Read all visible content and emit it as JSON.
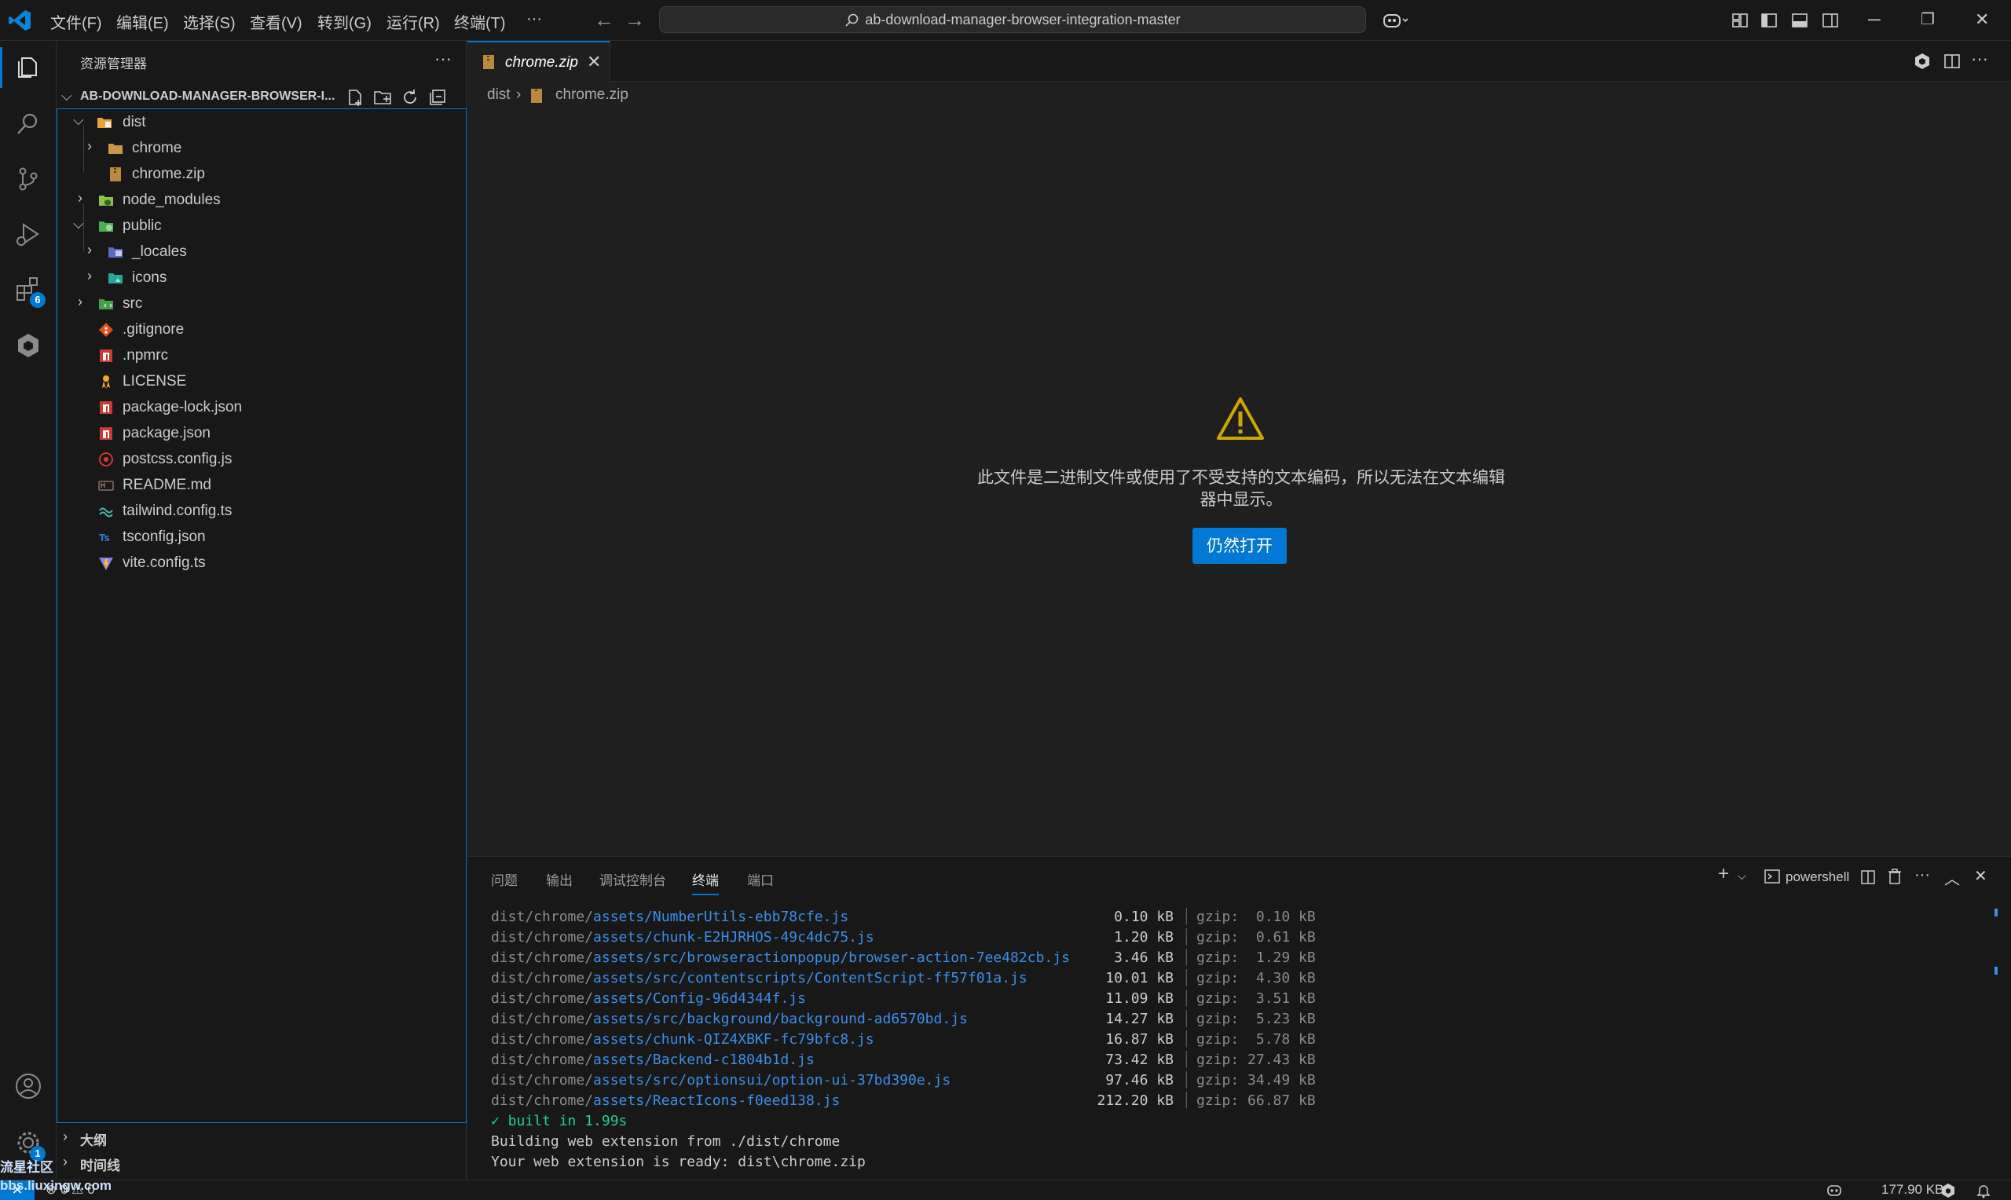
{
  "titlebar": {
    "menus": [
      "文件(F)",
      "编辑(E)",
      "选择(S)",
      "查看(V)",
      "转到(G)",
      "运行(R)",
      "终端(T)",
      "···"
    ],
    "search_text": "ab-download-manager-browser-integration-master"
  },
  "activitybar": {
    "extensions_badge": "6",
    "settings_badge": "1"
  },
  "sidebar": {
    "header": "资源管理器",
    "more": "···",
    "root_title": "AB-DOWNLOAD-MANAGER-BROWSER-I...",
    "tree": [
      {
        "name": "dist",
        "icon": "folder-dist-open-icon"
      },
      {
        "name": "chrome",
        "icon": "folder-chrome-icon"
      },
      {
        "name": "chrome.zip",
        "icon": "zip-file-icon"
      },
      {
        "name": "node_modules",
        "icon": "folder-node-icon"
      },
      {
        "name": "public",
        "icon": "folder-public-open-icon"
      },
      {
        "name": "_locales",
        "icon": "folder-locales-icon"
      },
      {
        "name": "icons",
        "icon": "folder-icons-icon"
      },
      {
        "name": "src",
        "icon": "folder-src-icon"
      },
      {
        "name": ".gitignore",
        "icon": "git-icon"
      },
      {
        "name": ".npmrc",
        "icon": "npm-icon"
      },
      {
        "name": "LICENSE",
        "icon": "license-icon"
      },
      {
        "name": "package-lock.json",
        "icon": "npm-icon"
      },
      {
        "name": "package.json",
        "icon": "npm-icon"
      },
      {
        "name": "postcss.config.js",
        "icon": "postcss-icon"
      },
      {
        "name": "README.md",
        "icon": "markdown-icon"
      },
      {
        "name": "tailwind.config.ts",
        "icon": "tailwind-icon"
      },
      {
        "name": "tsconfig.json",
        "icon": "typescript-config-icon"
      },
      {
        "name": "vite.config.ts",
        "icon": "vite-icon"
      }
    ],
    "outline": "大纲",
    "timeline": "时间线"
  },
  "editor": {
    "tab_label": "chrome.zip",
    "breadcrumb": [
      "dist",
      "chrome.zip"
    ],
    "message": "此文件是二进制文件或使用了不受支持的文本编码，所以无法在文本编辑器中显示。",
    "open_anyway": "仍然打开"
  },
  "panel": {
    "tabs": [
      "问题",
      "输出",
      "调试控制台",
      "终端",
      "端口"
    ],
    "active_tab": "终端",
    "shell": "powershell",
    "lines": [
      {
        "prefix": "dist/chrome/",
        "asset": "assets/NumberUtils-ebb78cfe.js",
        "size": "0.10 kB",
        "gzip": "gzip:  0.10 kB"
      },
      {
        "prefix": "dist/chrome/",
        "asset": "assets/chunk-E2HJRHOS-49c4dc75.js",
        "size": "1.20 kB",
        "gzip": "gzip:  0.61 kB"
      },
      {
        "prefix": "dist/chrome/",
        "asset": "assets/src/browseractionpopup/browser-action-7ee482cb.js",
        "size": "3.46 kB",
        "gzip": "gzip:  1.29 kB"
      },
      {
        "prefix": "dist/chrome/",
        "asset": "assets/src/contentscripts/ContentScript-ff57f01a.js",
        "size": "10.01 kB",
        "gzip": "gzip:  4.30 kB"
      },
      {
        "prefix": "dist/chrome/",
        "asset": "assets/Config-96d4344f.js",
        "size": "11.09 kB",
        "gzip": "gzip:  3.51 kB"
      },
      {
        "prefix": "dist/chrome/",
        "asset": "assets/src/background/background-ad6570bd.js",
        "size": "14.27 kB",
        "gzip": "gzip:  5.23 kB"
      },
      {
        "prefix": "dist/chrome/",
        "asset": "assets/chunk-QIZ4XBKF-fc79bfc8.js",
        "size": "16.87 kB",
        "gzip": "gzip:  5.78 kB"
      },
      {
        "prefix": "dist/chrome/",
        "asset": "assets/Backend-c1804b1d.js",
        "size": "73.42 kB",
        "gzip": "gzip: 27.43 kB"
      },
      {
        "prefix": "dist/chrome/",
        "asset": "assets/src/optionsui/option-ui-37bd390e.js",
        "size": "97.46 kB",
        "gzip": "gzip: 34.49 kB"
      },
      {
        "prefix": "dist/chrome/",
        "asset": "assets/ReactIcons-f0eed138.js",
        "size": "212.20 kB",
        "gzip": "gzip: 66.87 kB"
      }
    ],
    "built": "✓ built in 1.99s",
    "building": "Building web extension from ./dist/chrome",
    "ready": "Your web extension is ready: dist\\chrome.zip"
  },
  "statusbar": {
    "problems": "⊗ 0  ⚠ 0",
    "file_size": "177.90 KB"
  },
  "watermark": {
    "line1": "流星社区",
    "line2": "bbs.liuxingw.com"
  },
  "colors": {
    "accent": "#0078d4",
    "asset_link": "#3b8eea",
    "success": "#23d18b",
    "warning": "#cca700"
  }
}
